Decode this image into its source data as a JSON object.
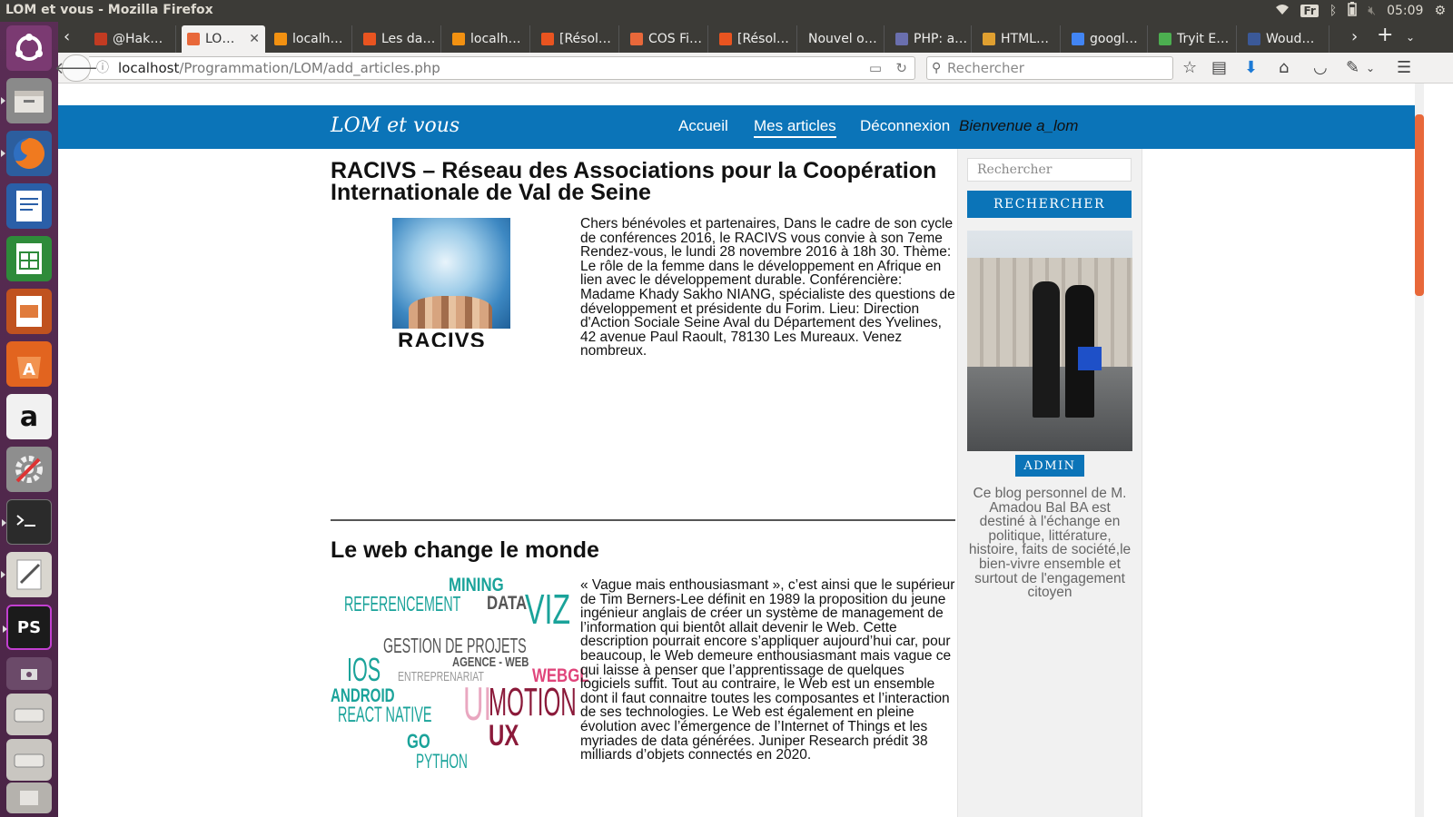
{
  "system": {
    "window_title": "LOM et vous - Mozilla Firefox",
    "keyboard_layout": "Fr",
    "clock": "05:09"
  },
  "tabs": [
    {
      "label": "@Hak…",
      "icon": "gmail-icon",
      "color": "#c23b22"
    },
    {
      "label": "LO…",
      "icon": "xampp-icon",
      "color": "#e8683a",
      "active": true
    },
    {
      "label": "localh…",
      "icon": "phpmyadmin-icon",
      "color": "#f29111"
    },
    {
      "label": "Les da…",
      "icon": "ubuntu-forum-icon",
      "color": "#e95420"
    },
    {
      "label": "localh…",
      "icon": "phpmyadmin-icon",
      "color": "#f29111"
    },
    {
      "label": "[Résol…",
      "icon": "ubuntu-forum-icon",
      "color": "#e95420"
    },
    {
      "label": "COS Fi…",
      "icon": "xampp-icon",
      "color": "#e8683a"
    },
    {
      "label": "[Résol…",
      "icon": "ubuntu-forum-icon",
      "color": "#e95420"
    },
    {
      "label": "Nouvel o…",
      "icon": "",
      "color": ""
    },
    {
      "label": "PHP: a…",
      "icon": "php-icon",
      "color": "#6a6fae"
    },
    {
      "label": "HTML…",
      "icon": "w3schools-icon",
      "color": "#e0a030"
    },
    {
      "label": "googl…",
      "icon": "google-icon",
      "color": "#4285f4"
    },
    {
      "label": "Tryit E…",
      "icon": "w3schools-icon",
      "color": "#4caf50"
    },
    {
      "label": "Woud…",
      "icon": "facebook-icon",
      "color": "#3b5998"
    }
  ],
  "navbar": {
    "url_host": "localhost",
    "url_path": "/Programmation/LOM/add_articles.php",
    "search_placeholder": "Rechercher"
  },
  "site": {
    "logo": "LOM et vous",
    "menu": [
      "Accueil",
      "Mes articles",
      "Déconnexion"
    ],
    "welcome": "Bienvenue a_lom"
  },
  "articles": [
    {
      "title": "RACIVS – Réseau des Associations pour la Coopération Internationale de Val de Seine",
      "image_caption": "RACIVS",
      "text": "Chers bénévoles et partenaires, Dans le cadre de son cycle de conférences 2016, le RACIVS vous convie à son 7eme Rendez-vous, le lundi 28 novembre 2016 à 18h 30. Thème: Le rôle de la femme dans le développement en Afrique en lien avec le développement durable. Conférencière: Madame Khady Sakho NIANG, spécialiste des questions de développement et présidente du Forim. Lieu: Direction d'Action Sociale Seine Aval du Département des Yvelines, 42 avenue Paul Raoult, 78130 Les Mureaux. Venez nombreux."
    },
    {
      "title": "Le web change le monde",
      "wordcloud": [
        "MINING",
        "REFERENCEMENT",
        "DATA",
        "VIZ",
        "GESTION DE PROJETS",
        "AGENCE - WEB",
        "IOS",
        "ENTREPRENARIAT",
        "WEBGL",
        "ANDROID",
        "UI",
        "MOTION",
        "REACT NATIVE",
        "UX",
        "GO",
        "PYTHON"
      ],
      "text": "« Vague mais enthousiasmant », c’est ainsi que le supérieur de Tim Berners-Lee définit en 1989 la proposition du jeune ingénieur anglais de créer un système de management de l’information qui bientôt allait devenir le Web. Cette description pourrait encore s’appliquer aujourd’hui car, pour beaucoup, le Web demeure enthousiasmant mais vague ce qui laisse à penser que l’apprentissage de quelques logiciels suffit. Tout au contraire, le Web est un ensemble dont il faut connaitre toutes les composantes et l’interaction de ses technologies. Le Web est également en pleine évolution avec l’émergence de l’Internet of Things et les myriades de data générées. Juniper Research prédit 38 milliards d’objets connectés en 2020."
    }
  ],
  "sidebar": {
    "search_placeholder": "Rechercher",
    "search_button": "RECHERCHER",
    "admin_label": "ADMIN",
    "bio": "Ce blog personnel de M. Amadou Bal BA est destiné à l'échange en politique, littérature, histoire, faits de société,le bien-vivre ensemble et surtout de l'engagement citoyen"
  },
  "colors": {
    "header_blue": "#0b74b8",
    "launcher_purple": "#5a2d55",
    "titlebar": "#3c3b37",
    "wordcloud_teal": "#1aa39a",
    "wordcloud_grey": "#555555",
    "wordcloud_pink": "#e0457b",
    "wordcloud_maroon": "#8b1a3a"
  },
  "launcher": [
    "ubuntu-dash-icon",
    "files-icon",
    "firefox-icon",
    "writer-icon",
    "calc-icon",
    "impress-icon",
    "software-center-icon",
    "amazon-icon",
    "system-settings-icon",
    "terminal-icon",
    "text-editor-icon",
    "phpstorm-icon",
    "screenshot-icon",
    "drive-icon",
    "drive-icon",
    "trash-icon"
  ]
}
